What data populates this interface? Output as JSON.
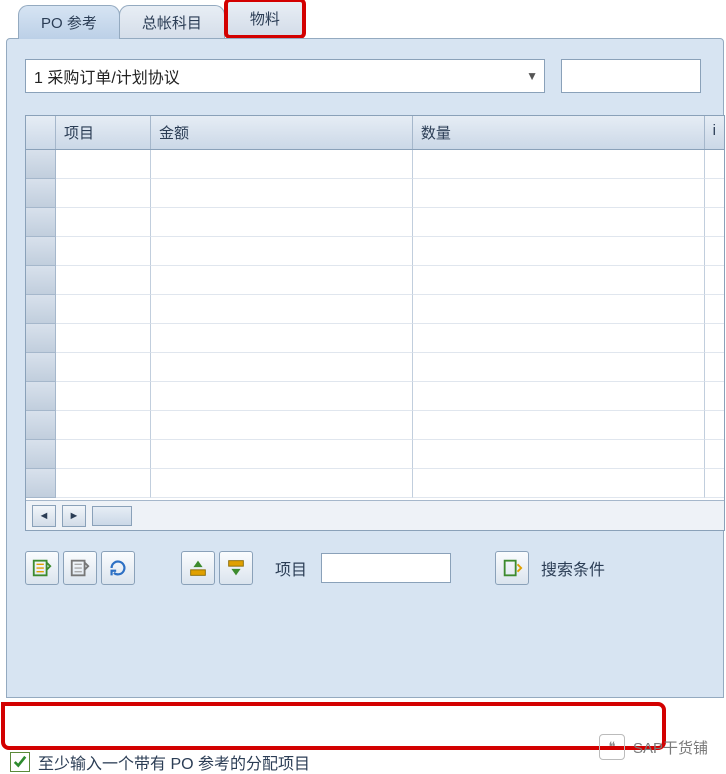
{
  "tabs": {
    "po_reference": "PO 参考",
    "gl_account": "总帐科目",
    "material": "物料"
  },
  "dropdown": {
    "value": "1 采购订单/计划协议"
  },
  "grid": {
    "cols": {
      "item": "项目",
      "amount": "金额",
      "qty": "数量",
      "last": "i"
    }
  },
  "toolbar": {
    "item_label": "项目",
    "search_label": "搜索条件"
  },
  "status": {
    "message": "至少输入一个带有 PO 参考的分配项目"
  },
  "watermark": {
    "text": "SAP干货铺"
  }
}
